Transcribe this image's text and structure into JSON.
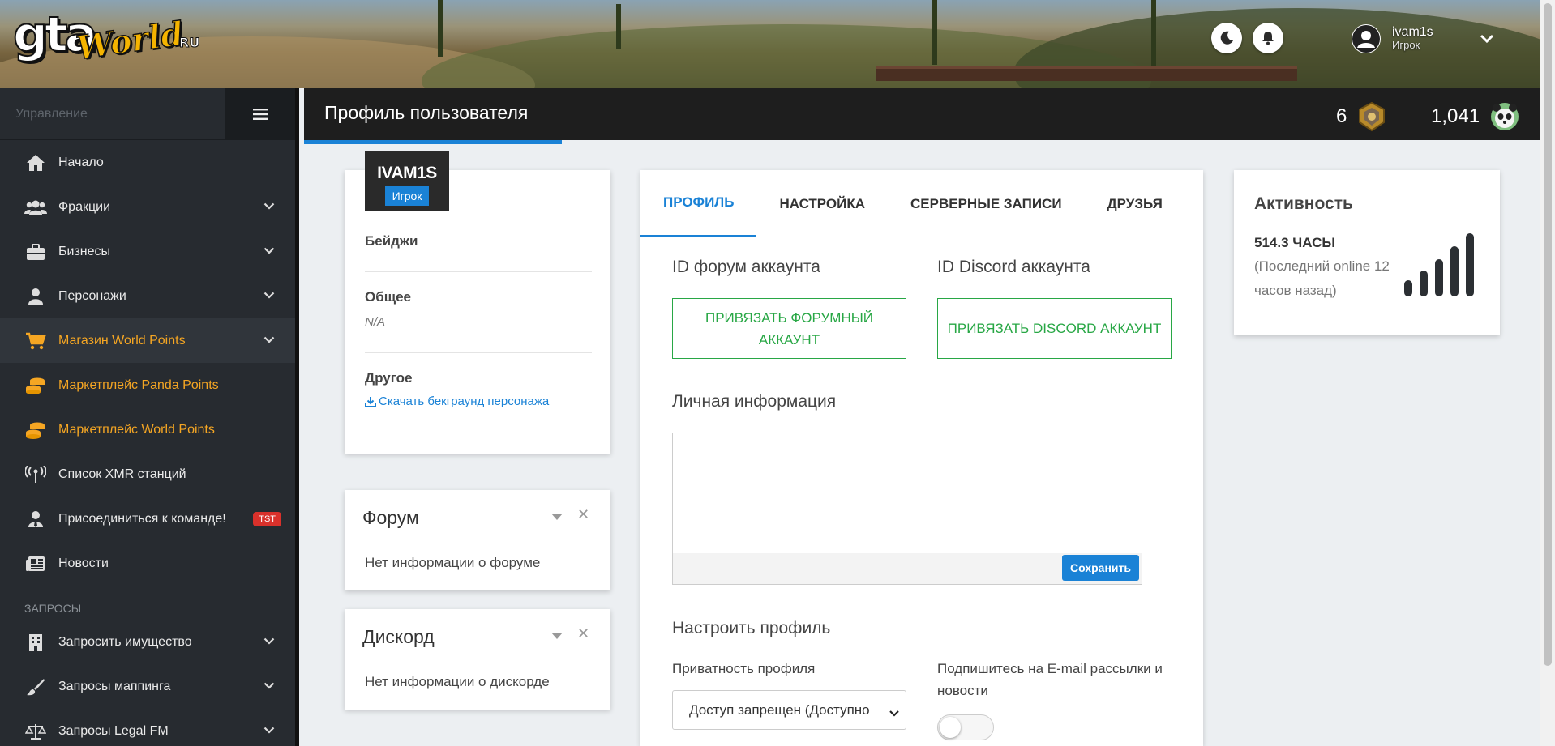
{
  "header": {
    "logo": {
      "gta": "gta",
      "world": "World",
      "ru": "RU"
    },
    "user": {
      "name": "ivam1s",
      "role": "Игрок"
    }
  },
  "sidebar": {
    "label": "Управление",
    "items": [
      {
        "label": "Начало",
        "icon": "home-icon"
      },
      {
        "label": "Фракции",
        "icon": "users-icon",
        "chevron": true
      },
      {
        "label": "Бизнесы",
        "icon": "briefcase-icon",
        "chevron": true
      },
      {
        "label": "Персонажи",
        "icon": "user-icon",
        "chevron": true
      },
      {
        "label": "Магазин World Points",
        "icon": "cart-icon",
        "chevron": true,
        "active": true
      },
      {
        "label": "Маркетплейс Panda Points",
        "icon": "coins-icon"
      },
      {
        "label": "Маркетплейс World Points",
        "icon": "coins-icon"
      },
      {
        "label": "Список XMR станций",
        "icon": "antenna-icon"
      },
      {
        "label": "Присоединиться к команде!",
        "icon": "user-tie-icon",
        "badge": "TST"
      },
      {
        "label": "Новости",
        "icon": "newspaper-icon"
      }
    ],
    "section": "ЗАПРОСЫ",
    "requests": [
      {
        "label": "Запросить имущество",
        "icon": "building-icon"
      },
      {
        "label": "Запросы маппинга",
        "icon": "brush-icon"
      },
      {
        "label": "Запросы Legal FM",
        "icon": "scale-icon"
      }
    ]
  },
  "titlebar": {
    "title": "Профиль пользователя",
    "stat1": "6",
    "stat2": "1,041"
  },
  "profile": {
    "name": "IVAM1S",
    "role": "Игрок",
    "badges": "Бейджи",
    "general": "Общее",
    "general_value": "N/A",
    "other": "Другое",
    "download": "Скачать бекграунд персонажа"
  },
  "forum_card": {
    "title": "Форум",
    "body": "Нет информации о форуме"
  },
  "discord_card": {
    "title": "Дискорд",
    "body": "Нет информации о дискорде"
  },
  "tabs": [
    "ПРОФИЛЬ",
    "НАСТРОЙКА",
    "СЕРВЕРНЫЕ ЗАПИСИ",
    "ДРУЗЬЯ"
  ],
  "main": {
    "forum_id_title": "ID форум аккаунта",
    "discord_id_title": "ID Discord аккаунта",
    "link_forum": "ПРИВЯЗАТЬ ФОРУМНЫЙ АККАУНТ",
    "link_discord": "ПРИВЯЗАТЬ DISCORD АККАУНТ",
    "personal_title": "Личная информация",
    "personal_value": "",
    "save": "Сохранить",
    "configure_title": "Настроить профиль",
    "privacy_label": "Приватность профиля",
    "privacy_value": "Доступ запрещен (Доступно",
    "subscribe_label": "Подпишитесь на E-mail рассылки и новости",
    "subscribe_on": false
  },
  "activity": {
    "title": "Активность",
    "hours": "514.3 ЧАСЫ",
    "last_online": "(Последний online 12 часов назад)"
  },
  "colors": {
    "accent": "#1a82d6",
    "sidebar": "#272b30",
    "orange": "#f5a623",
    "green": "#28a745",
    "badge_red": "#d9312b"
  }
}
